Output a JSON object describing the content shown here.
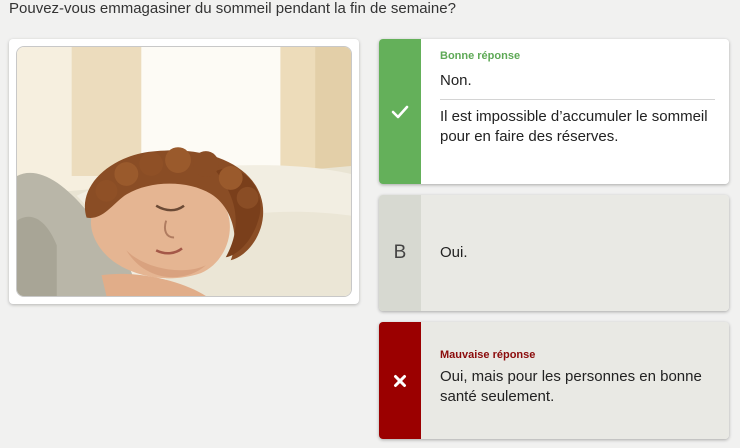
{
  "question": "Pouvez-vous emmagasiner du sommeil pendant la fin de semaine?",
  "image": {
    "icon": "sleeping-person-illustration"
  },
  "answers": [
    {
      "status_label": "Bonne réponse",
      "text": "Non.",
      "explanation": "Il est impossible d’accumuler le sommeil pour en faire des réserves.",
      "marker_icon": "checkmark-icon",
      "accent_color": "#64b05a"
    },
    {
      "letter": "B",
      "text": "Oui.",
      "accent_color": "#d7d9d1"
    },
    {
      "status_label": "Mauvaise réponse",
      "text": "Oui, mais pour les personnes en bonne santé seulement.",
      "marker_icon": "cross-icon",
      "accent_color": "#9b0000"
    }
  ]
}
